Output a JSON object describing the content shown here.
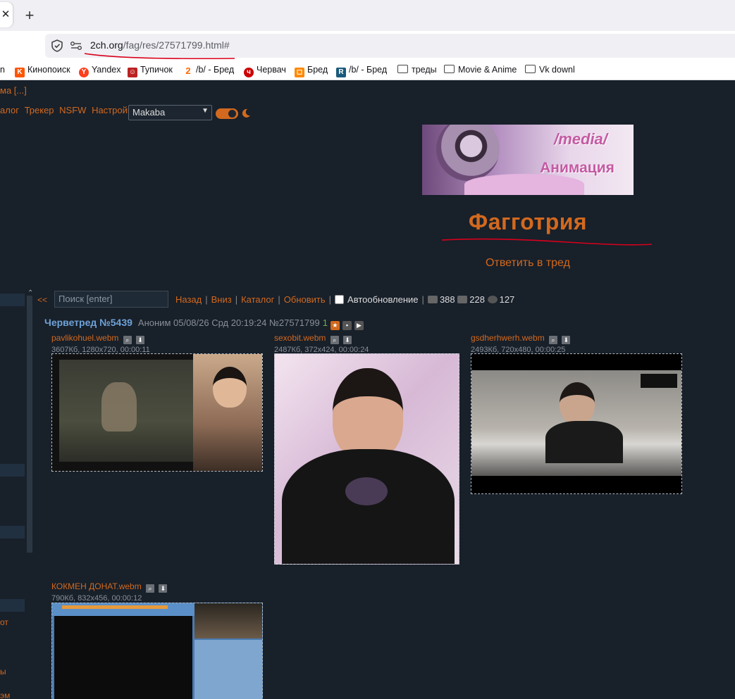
{
  "browser": {
    "url_host": "2ch.org",
    "url_path": "/fag/res/27571799.html#",
    "bookmarks": [
      {
        "label": "n",
        "icon": "generic"
      },
      {
        "label": "Кинопоиск",
        "icon": "kinopoisk-icon"
      },
      {
        "label": "Yandex",
        "icon": "yandex-icon"
      },
      {
        "label": "Тупичок",
        "icon": "site-icon"
      },
      {
        "label": "/b/ - Бред",
        "icon": "2ch-icon"
      },
      {
        "label": "Червач",
        "icon": "worm-icon"
      },
      {
        "label": "Бред",
        "icon": "site-icon"
      },
      {
        "label": "/b/ - Бред",
        "icon": "site-icon"
      },
      {
        "label": "треды",
        "icon": "folder-icon"
      },
      {
        "label": "Movie & Anime",
        "icon": "folder-icon"
      },
      {
        "label": "Vk downl",
        "icon": "folder-icon"
      }
    ]
  },
  "page": {
    "top_links": "ма  [...]",
    "menu": [
      "алог",
      "Трекер",
      "NSFW",
      "Настройки"
    ],
    "style_select": "Makaba",
    "banner_line1": "/media/",
    "banner_line2": "Анимация",
    "board_title": "Фагготрия",
    "reply_link": "Ответить в тред",
    "sidebar_texts": [
      "от",
      "ы",
      "эм"
    ],
    "nav": {
      "back": "<<",
      "search_placeholder": "Поиск [enter]",
      "links": [
        "Назад",
        "Вниз",
        "Каталог",
        "Обновить"
      ],
      "autoupdate": "Автообновление",
      "posts": "388",
      "files": "228",
      "posters": "127"
    },
    "post": {
      "subject": "Черветред №5439",
      "meta": "Аноним 05/08/26 Срд 20:19:24 №27571799",
      "badge": "1"
    },
    "files": [
      {
        "name": "pavlikohuel.webm",
        "info": "3607Кб, 1280x720, 00:00:11"
      },
      {
        "name": "sexobit.webm",
        "info": "2487Кб, 372x424, 00:00:24"
      },
      {
        "name": "gsdherhwerh.webm",
        "info": "2493Кб, 720x480, 00:00:25"
      },
      {
        "name": "КОКМЕН ДОНАТ.webm",
        "info": "790Кб, 832x456, 00:00:12"
      }
    ]
  },
  "colors": {
    "accent": "#d2691e",
    "background": "#18202a",
    "subject": "#6fa3d8"
  }
}
